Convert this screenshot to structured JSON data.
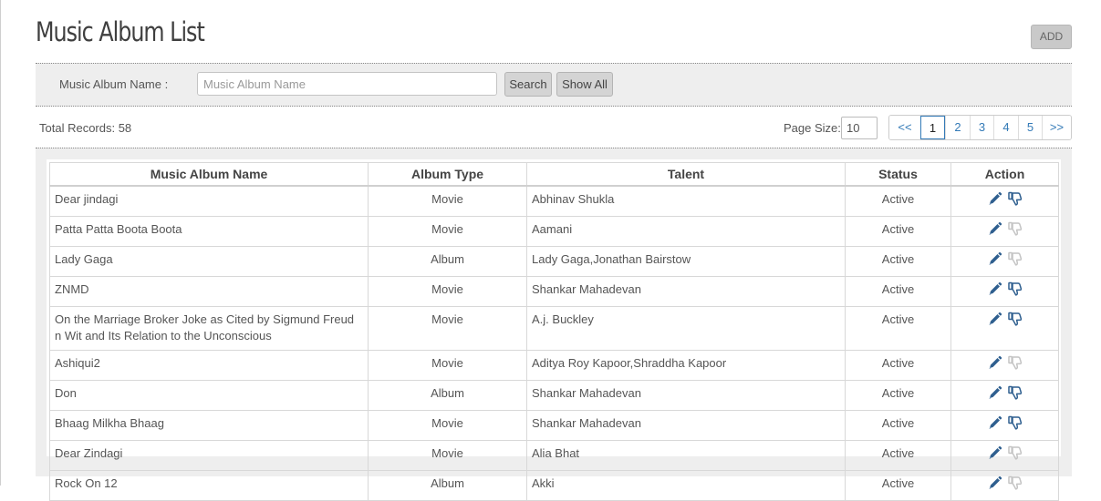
{
  "page": {
    "title": "Music Album List",
    "add_label": "ADD"
  },
  "search": {
    "label": "Music Album Name :",
    "placeholder": "Music Album Name",
    "value": "",
    "search_label": "Search",
    "show_all_label": "Show All"
  },
  "summary": {
    "total_label": "Total Records:  58",
    "page_size_label": "Page Size:",
    "page_size_value": "10"
  },
  "pagination": {
    "items": [
      {
        "label": "<<",
        "active": false
      },
      {
        "label": "1",
        "active": true
      },
      {
        "label": "2",
        "active": false
      },
      {
        "label": "3",
        "active": false
      },
      {
        "label": "4",
        "active": false
      },
      {
        "label": "5",
        "active": false
      },
      {
        "label": ">>",
        "active": false
      }
    ]
  },
  "table": {
    "columns": [
      "Music Album Name",
      "Album Type",
      "Talent",
      "Status",
      "Action"
    ],
    "rows": [
      {
        "name": "Dear jindagi",
        "type": "Movie",
        "talent": "Abhinav Shukla",
        "status": "Active",
        "thumb_active": true
      },
      {
        "name": "Patta Patta Boota Boota",
        "type": "Movie",
        "talent": "Aamani",
        "status": "Active",
        "thumb_active": false
      },
      {
        "name": "Lady Gaga",
        "type": "Album",
        "talent": "Lady Gaga,Jonathan Bairstow",
        "status": "Active",
        "thumb_active": false
      },
      {
        "name": "ZNMD",
        "type": "Movie",
        "talent": "Shankar Mahadevan",
        "status": "Active",
        "thumb_active": true
      },
      {
        "name": "On the Marriage Broker Joke as Cited by Sigmund Freud n Wit and Its Relation to the Unconscious",
        "type": "Movie",
        "talent": "A.j. Buckley",
        "status": "Active",
        "thumb_active": true
      },
      {
        "name": "Ashiqui2",
        "type": "Movie",
        "talent": "Aditya Roy Kapoor,Shraddha Kapoor",
        "status": "Active",
        "thumb_active": false
      },
      {
        "name": "Don",
        "type": "Album",
        "talent": "Shankar Mahadevan",
        "status": "Active",
        "thumb_active": true
      },
      {
        "name": "Bhaag Milkha Bhaag",
        "type": "Movie",
        "talent": "Shankar Mahadevan",
        "status": "Active",
        "thumb_active": true
      },
      {
        "name": "Dear Zindagi",
        "type": "Movie",
        "talent": "Alia Bhat",
        "status": "Active",
        "thumb_active": false
      },
      {
        "name": "Rock On 12",
        "type": "Album",
        "talent": "Akki",
        "status": "Active",
        "thumb_active": false
      }
    ]
  },
  "icons": {
    "edit": "pencil-icon",
    "thumb": "thumbs-down-icon"
  },
  "colors": {
    "link": "#337ab7",
    "icon_active": "#2f5f8f",
    "icon_inactive": "#c4c4c4"
  }
}
